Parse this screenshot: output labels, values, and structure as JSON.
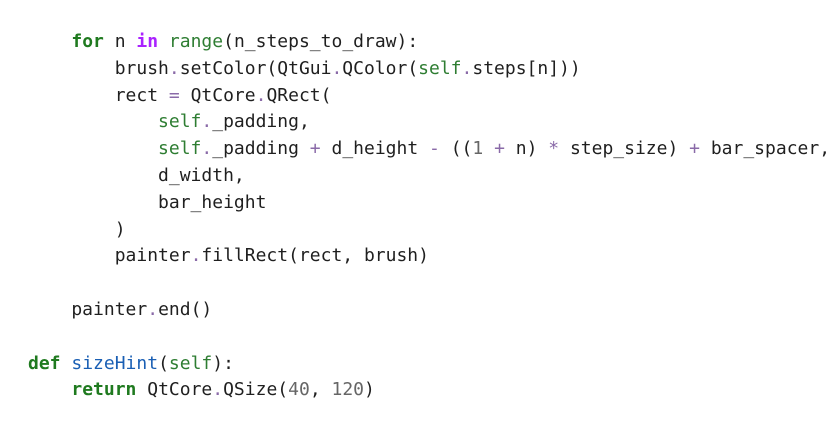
{
  "code": {
    "lines": [
      [
        {
          "t": "    ",
          "c": "ident"
        },
        {
          "t": "for",
          "c": "kw"
        },
        {
          "t": " n ",
          "c": "ident"
        },
        {
          "t": "in",
          "c": "kw-in"
        },
        {
          "t": " ",
          "c": "ident"
        },
        {
          "t": "range",
          "c": "builtin"
        },
        {
          "t": "(n_steps_to_draw):",
          "c": "ident"
        }
      ],
      [
        {
          "t": "        brush",
          "c": "ident"
        },
        {
          "t": ".",
          "c": "op"
        },
        {
          "t": "setColor(QtGui",
          "c": "ident"
        },
        {
          "t": ".",
          "c": "op"
        },
        {
          "t": "QColor(",
          "c": "ident"
        },
        {
          "t": "self",
          "c": "selfkw"
        },
        {
          "t": ".",
          "c": "op"
        },
        {
          "t": "steps[n]))",
          "c": "ident"
        }
      ],
      [
        {
          "t": "        rect ",
          "c": "ident"
        },
        {
          "t": "=",
          "c": "op"
        },
        {
          "t": " QtCore",
          "c": "ident"
        },
        {
          "t": ".",
          "c": "op"
        },
        {
          "t": "QRect(",
          "c": "ident"
        }
      ],
      [
        {
          "t": "            ",
          "c": "ident"
        },
        {
          "t": "self",
          "c": "selfkw"
        },
        {
          "t": ".",
          "c": "op"
        },
        {
          "t": "_padding,",
          "c": "ident"
        }
      ],
      [
        {
          "t": "            ",
          "c": "ident"
        },
        {
          "t": "self",
          "c": "selfkw"
        },
        {
          "t": ".",
          "c": "op"
        },
        {
          "t": "_padding ",
          "c": "ident"
        },
        {
          "t": "+",
          "c": "op"
        },
        {
          "t": " d_height ",
          "c": "ident"
        },
        {
          "t": "-",
          "c": "op"
        },
        {
          "t": " ((",
          "c": "ident"
        },
        {
          "t": "1",
          "c": "num"
        },
        {
          "t": " ",
          "c": "ident"
        },
        {
          "t": "+",
          "c": "op"
        },
        {
          "t": " n) ",
          "c": "ident"
        },
        {
          "t": "*",
          "c": "op"
        },
        {
          "t": " step_size) ",
          "c": "ident"
        },
        {
          "t": "+",
          "c": "op"
        },
        {
          "t": " bar_spacer,",
          "c": "ident"
        }
      ],
      [
        {
          "t": "            d_width,",
          "c": "ident"
        }
      ],
      [
        {
          "t": "            bar_height",
          "c": "ident"
        }
      ],
      [
        {
          "t": "        )",
          "c": "ident"
        }
      ],
      [
        {
          "t": "        painter",
          "c": "ident"
        },
        {
          "t": ".",
          "c": "op"
        },
        {
          "t": "fillRect(rect, brush)",
          "c": "ident"
        }
      ],
      [
        {
          "t": "",
          "c": "ident"
        }
      ],
      [
        {
          "t": "    painter",
          "c": "ident"
        },
        {
          "t": ".",
          "c": "op"
        },
        {
          "t": "end()",
          "c": "ident"
        }
      ],
      [
        {
          "t": "",
          "c": "ident"
        }
      ],
      [
        {
          "t": "def",
          "c": "kw"
        },
        {
          "t": " ",
          "c": "ident"
        },
        {
          "t": "sizeHint",
          "c": "fn"
        },
        {
          "t": "(",
          "c": "ident"
        },
        {
          "t": "self",
          "c": "selfkw"
        },
        {
          "t": "):",
          "c": "ident"
        }
      ],
      [
        {
          "t": "    ",
          "c": "ident"
        },
        {
          "t": "return",
          "c": "kw"
        },
        {
          "t": " QtCore",
          "c": "ident"
        },
        {
          "t": ".",
          "c": "op"
        },
        {
          "t": "QSize(",
          "c": "ident"
        },
        {
          "t": "40",
          "c": "num"
        },
        {
          "t": ", ",
          "c": "ident"
        },
        {
          "t": "120",
          "c": "num"
        },
        {
          "t": ")",
          "c": "ident"
        }
      ]
    ]
  }
}
